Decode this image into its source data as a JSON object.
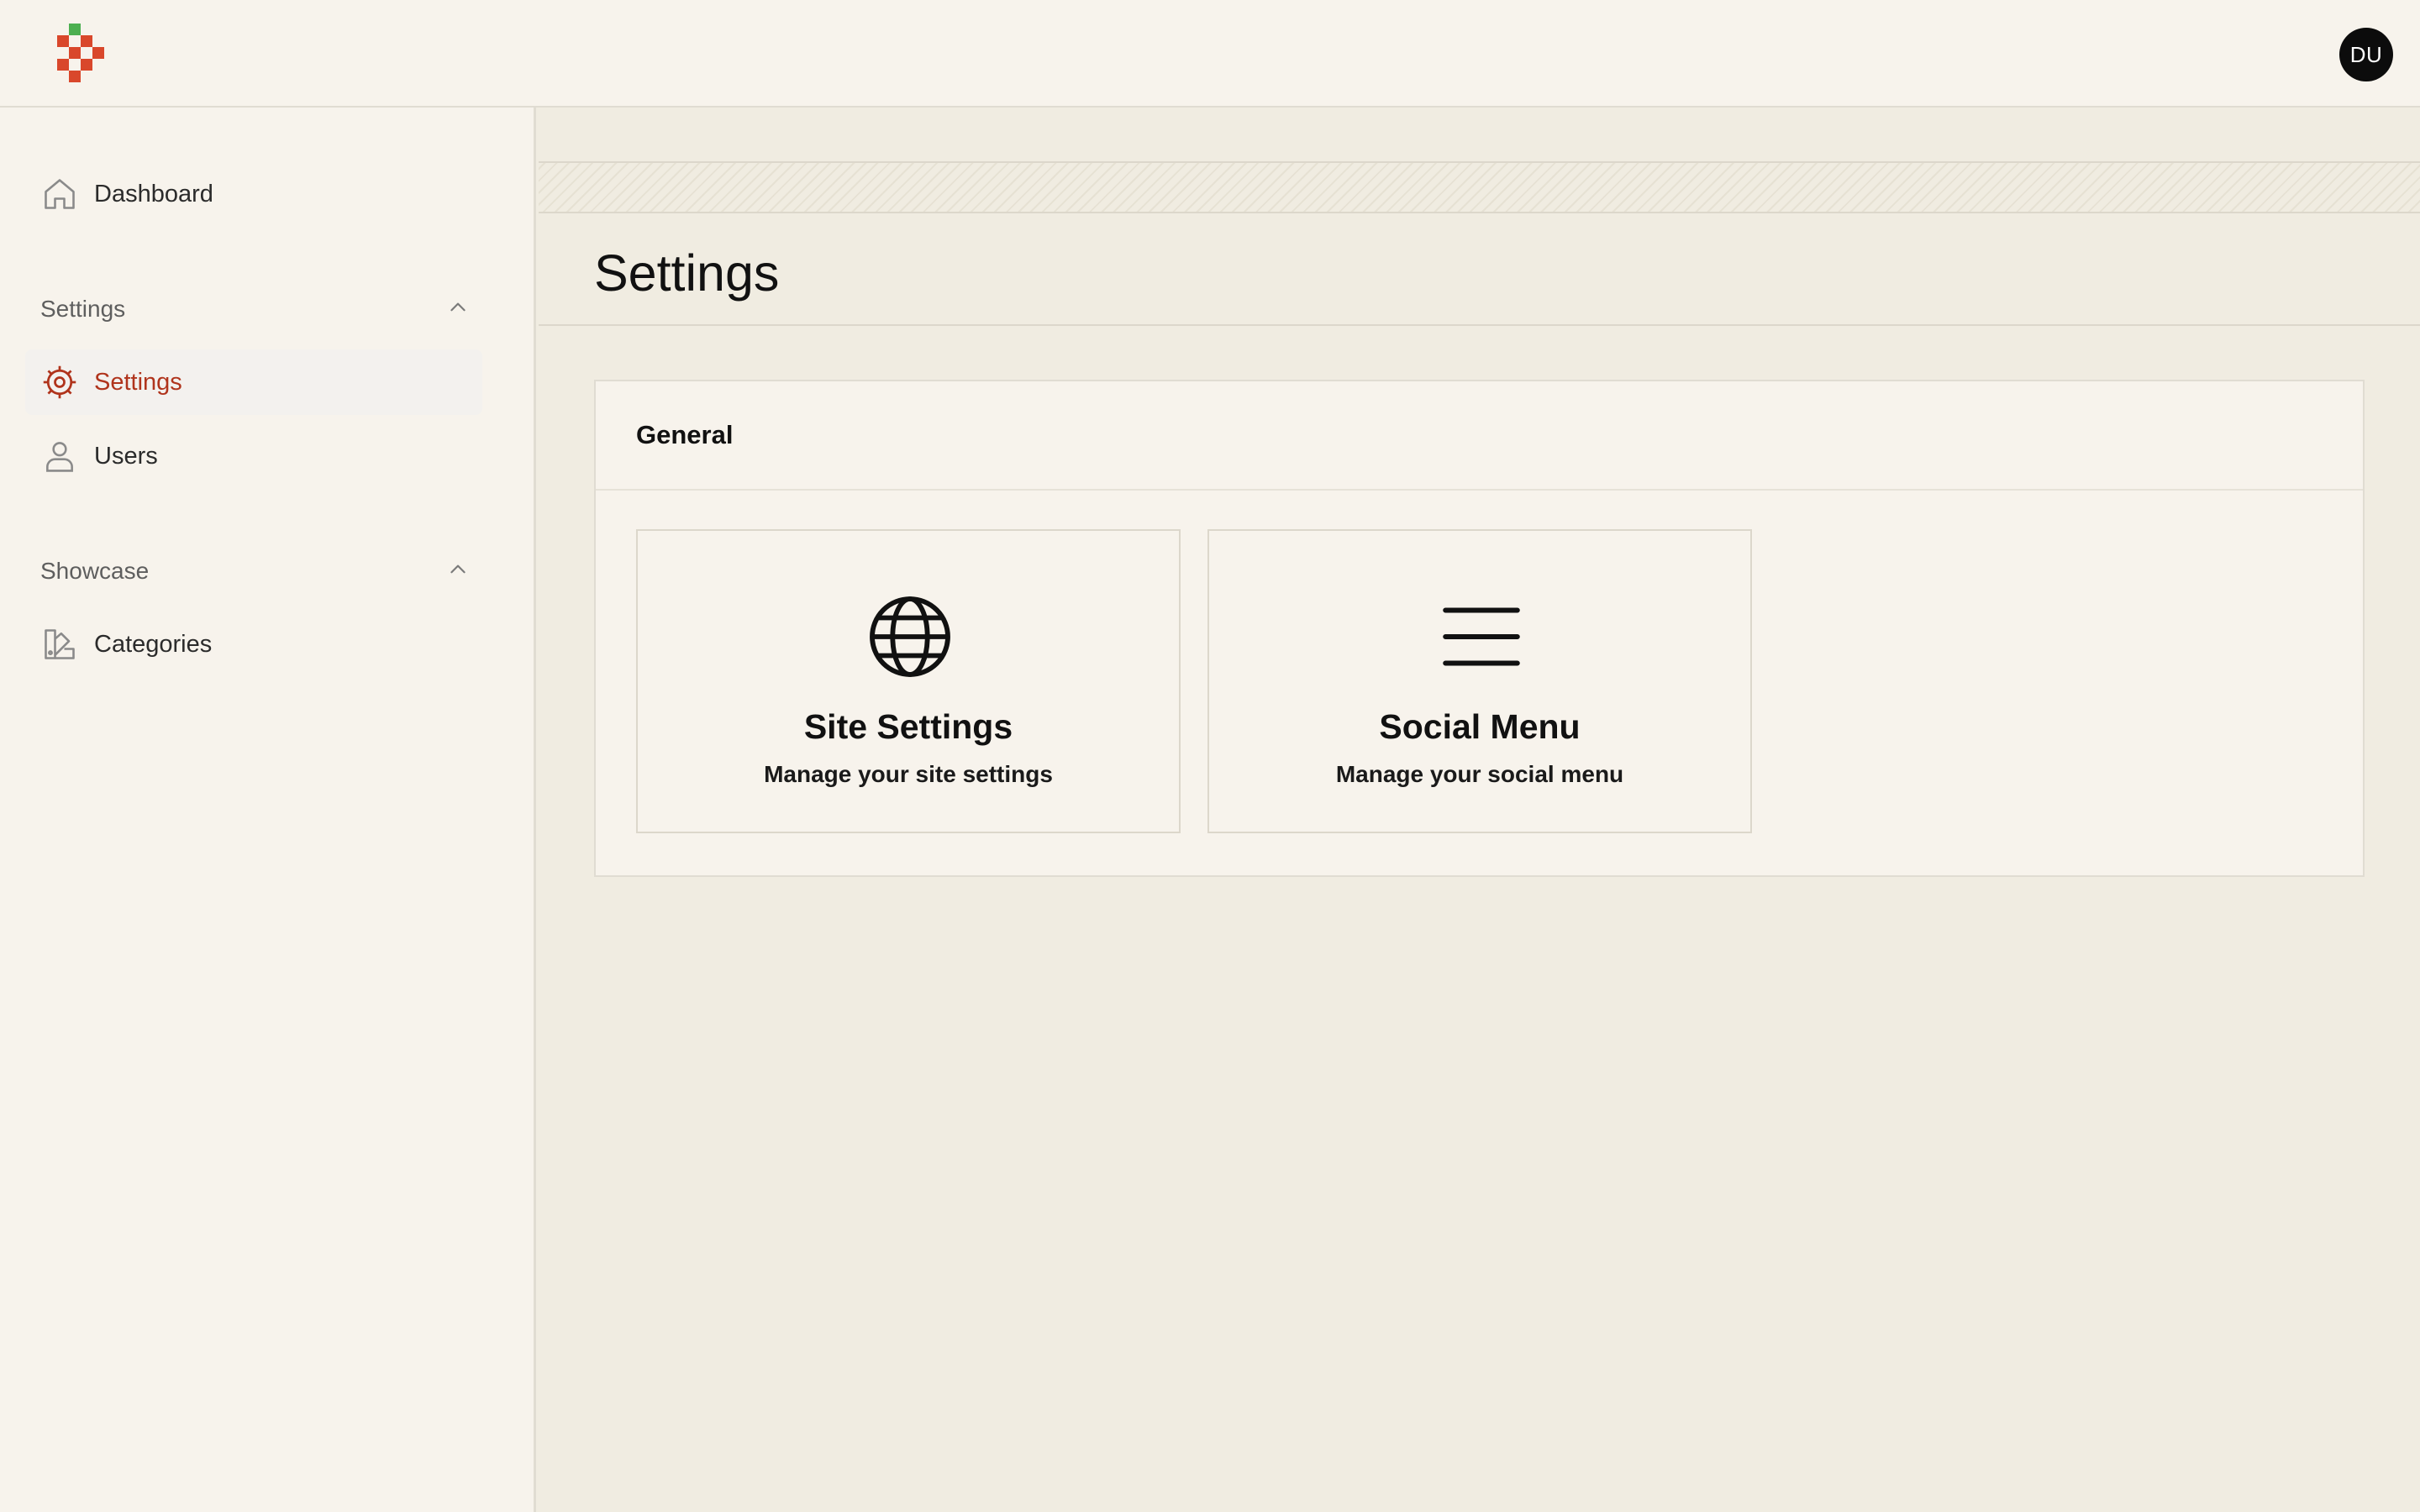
{
  "header": {
    "logo_icon": "pixel-logo-icon",
    "avatar_initials": "DU"
  },
  "sidebar": {
    "dashboard": {
      "label": "Dashboard",
      "icon": "home-icon"
    },
    "groups": [
      {
        "label": "Settings",
        "icon": "chevron-up-icon",
        "items": [
          {
            "label": "Settings",
            "icon": "gear-icon",
            "active": true
          },
          {
            "label": "Users",
            "icon": "user-icon",
            "active": false
          }
        ]
      },
      {
        "label": "Showcase",
        "icon": "chevron-up-icon",
        "items": [
          {
            "label": "Categories",
            "icon": "swatch-book-icon",
            "active": false
          }
        ]
      }
    ]
  },
  "main": {
    "page_title": "Settings",
    "panel": {
      "title": "General",
      "tiles": [
        {
          "title": "Site Settings",
          "description": "Manage your site settings",
          "icon": "globe-icon"
        },
        {
          "title": "Social Menu",
          "description": "Manage your social menu",
          "icon": "menu-icon"
        }
      ]
    }
  },
  "colors": {
    "accent": "#b0341c",
    "logo_red": "#d9472b",
    "logo_green": "#4caf50",
    "sidebar_bg": "#f7f3ec",
    "main_bg": "#f0ece1"
  }
}
